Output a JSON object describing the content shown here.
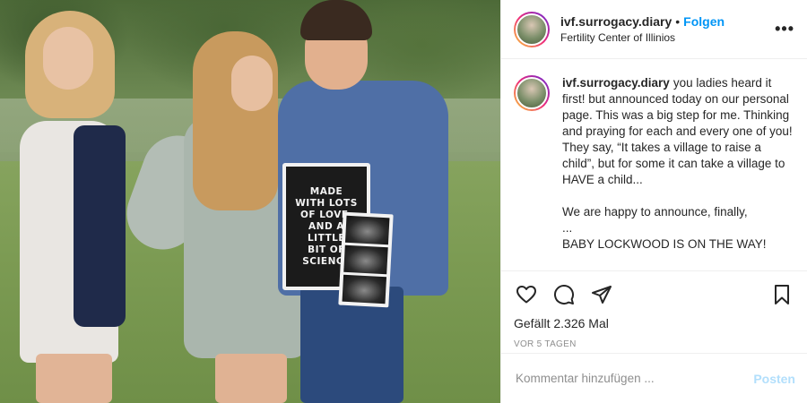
{
  "header": {
    "username": "ivf.surrogacy.diary",
    "separator": "•",
    "follow_label": "Folgen",
    "location": "Fertility Center of Illinios",
    "more_label": "•••"
  },
  "photo": {
    "board_lines": [
      "MADE",
      "WITH LOTS",
      "OF LOVE,",
      "AND A",
      "LITTLE",
      "BIT OF",
      "SCIENCE"
    ]
  },
  "caption": {
    "username": "ivf.surrogacy.diary",
    "text": "you ladies heard it first! but announced today on our personal page. This was a big step for me. Thinking and praying for each and every one of you!\nThey say, “It takes a village to raise a child”, but for some it can take a village to HAVE a child...\n\nWe are happy to announce, finally,\n...\nBABY LOCKWOOD IS ON THE WAY!"
  },
  "actions": {
    "icons": [
      "heart-icon",
      "comment-icon",
      "share-icon",
      "bookmark-icon"
    ]
  },
  "likes_text": "Gefällt 2.326 Mal",
  "time_text": "VOR 5 TAGEN",
  "comment": {
    "placeholder": "Kommentar hinzufügen ...",
    "post_label": "Posten"
  },
  "colors": {
    "link_blue": "#0095f6",
    "post_disabled": "#b2dffc",
    "muted": "#8e8e8e"
  }
}
